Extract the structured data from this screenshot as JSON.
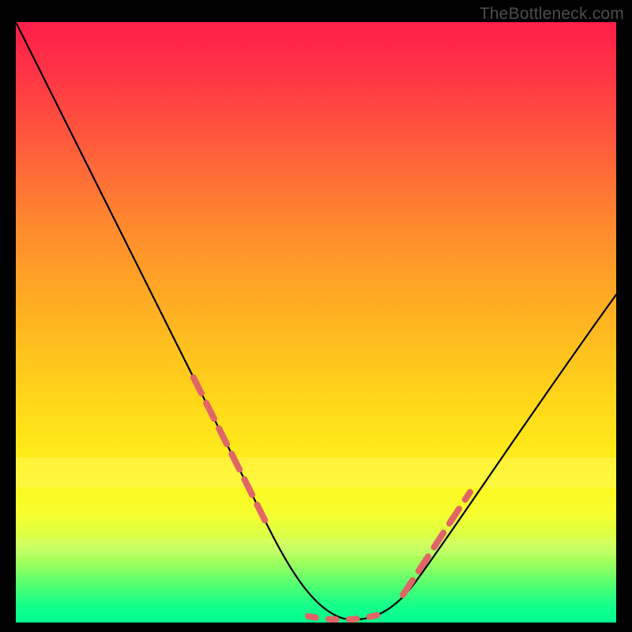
{
  "watermark": "TheBottleneck.com",
  "colors": {
    "background": "#000000",
    "gradient_top": "#ff1e49",
    "gradient_mid": "#ffd41a",
    "gradient_bottom": "#00ff90",
    "curve": "#000000",
    "highlight": "#e06666",
    "watermark": "#4d4d4d"
  },
  "chart_data": {
    "type": "line",
    "title": "",
    "xlabel": "",
    "ylabel": "",
    "xlim": [
      0,
      100
    ],
    "ylim": [
      0,
      100
    ],
    "grid": false,
    "legend": false,
    "annotations": [],
    "series": [
      {
        "name": "bottleneck-curve",
        "x": [
          0,
          3,
          8,
          13,
          18,
          23,
          28,
          33,
          38,
          43,
          47,
          50,
          53,
          57,
          60,
          65,
          70,
          75,
          80,
          85,
          90,
          95,
          100
        ],
        "y": [
          100,
          95,
          86,
          77,
          68,
          58,
          48,
          38,
          28,
          18,
          10,
          5,
          2,
          0,
          0,
          3,
          8,
          15,
          22,
          29,
          36,
          43,
          50
        ]
      }
    ],
    "highlight_segments": [
      {
        "name": "left-band",
        "x_range": [
          28,
          43
        ],
        "note": "dashed pink overlay on descending side near low band"
      },
      {
        "name": "bottom-dots",
        "x_range": [
          50,
          60
        ],
        "note": "pink dash/dots along the valley floor"
      },
      {
        "name": "right-band",
        "x_range": [
          64,
          73
        ],
        "note": "dashed pink overlay on ascending side near low band"
      }
    ]
  }
}
